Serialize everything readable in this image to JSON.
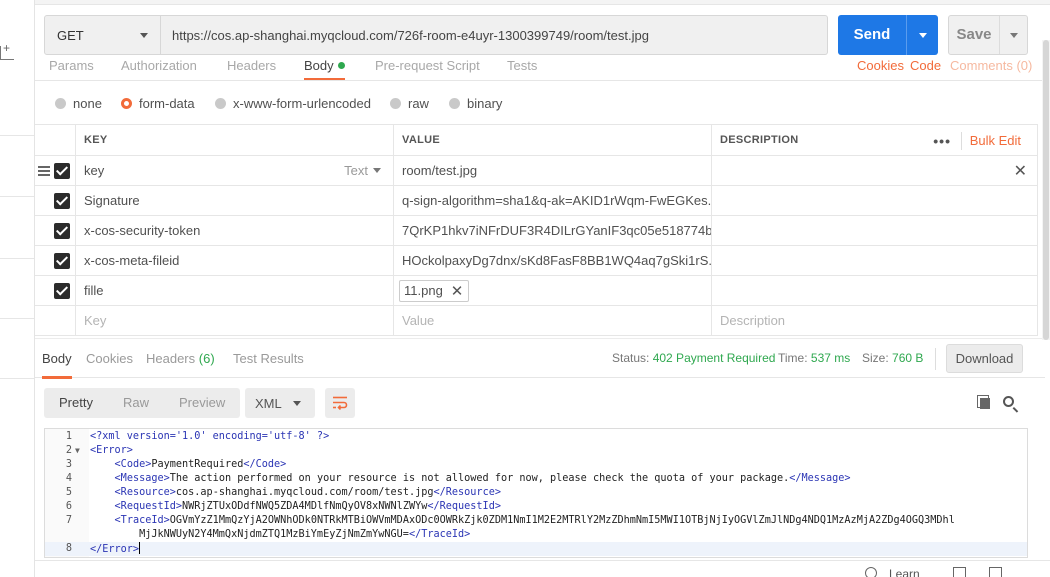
{
  "request": {
    "method": "GET",
    "url": "https://cos.ap-shanghai.myqcloud.com/726f-room-e4uyr-1300399749/room/test.jpg",
    "send_label": "Send",
    "save_label": "Save"
  },
  "request_tabs": {
    "params": "Params",
    "authorization": "Authorization",
    "headers": "Headers",
    "body": "Body",
    "prerequest": "Pre-request Script",
    "tests": "Tests",
    "cookies": "Cookies",
    "code": "Code",
    "comments": "Comments (0)"
  },
  "body_types": {
    "none": "none",
    "form_data": "form-data",
    "urlencoded": "x-www-form-urlencoded",
    "raw": "raw",
    "binary": "binary",
    "selected": "form-data"
  },
  "params_table": {
    "headers": {
      "key": "KEY",
      "value": "VALUE",
      "description": "DESCRIPTION",
      "bulk_edit": "Bulk Edit"
    },
    "rows": [
      {
        "key": "key",
        "type": "Text",
        "value": "room/test.jpg",
        "checked": true
      },
      {
        "key": "Signature",
        "value": "q-sign-algorithm=sha1&q-ak=AKID1rWqm-FwEGKes...",
        "checked": true
      },
      {
        "key": "x-cos-security-token",
        "value": "7QrKP1hkv7iNFrDUF3R4DILrGYanIF3qc05e518774b...",
        "checked": true
      },
      {
        "key": "x-cos-meta-fileid",
        "value": "HOckolpaxyDg7dnx/sKd8FasF8BB1WQ4aq7gSki1rS...",
        "checked": true
      },
      {
        "key": "fille",
        "value": "11.png",
        "checked": true
      }
    ],
    "placeholders": {
      "key": "Key",
      "value": "Value",
      "description": "Description"
    }
  },
  "response_tabs": {
    "body": "Body",
    "cookies": "Cookies",
    "headers": "Headers",
    "headers_count": "(6)",
    "test_results": "Test Results"
  },
  "response_status": {
    "status_label": "Status:",
    "status_value": "402 Payment Required",
    "time_label": "Time:",
    "time_value": "537 ms",
    "size_label": "Size:",
    "size_value": "760 B",
    "download_label": "Download"
  },
  "response_view": {
    "pretty": "Pretty",
    "raw": "Raw",
    "preview": "Preview",
    "format": "XML"
  },
  "code_lines": [
    {
      "n": "1",
      "text": "<?xml version='1.0' encoding='utf-8' ?>"
    },
    {
      "n": "2",
      "text": "<Error>"
    },
    {
      "n": "3",
      "text": "    <Code>PaymentRequired</Code>"
    },
    {
      "n": "4",
      "text": "    <Message>The action performed on your resource is not allowed for now, please check the quota of your package.</Message>"
    },
    {
      "n": "5",
      "text": "    <Resource>cos.ap-shanghai.myqcloud.com/room/test.jpg</Resource>"
    },
    {
      "n": "6",
      "text": "    <RequestId>NWRjZTUxODdfNWQ5ZDA4MDlfNmQyOV8xNWNlZWYw</RequestId>"
    },
    {
      "n": "7",
      "text": "    <TraceId>OGVmYzZ1MmQzYjA2OWNhODk0NTRkMTBiOWVmMDAxODc0OWRkZjk0ZDM1NmI1M2E2MTRlY2MzZDhmNmI5MWI1OTBjNjIyOGVlZmJlNDg4NDQ1MzAzMjA2ZDg4OGQ3MDhl"
    },
    {
      "n": "",
      "text": "        MjJkNWUyN2Y4MmQxNjdmZTQ1MzBiYmEyZjNmZmYwNGU=</TraceId>"
    },
    {
      "n": "8",
      "text": "</Error>"
    }
  ],
  "footer": {
    "learn": "Learn"
  },
  "colors": {
    "accent": "#f26b3a",
    "primary": "#1e78e6",
    "success": "#2fa84f"
  }
}
